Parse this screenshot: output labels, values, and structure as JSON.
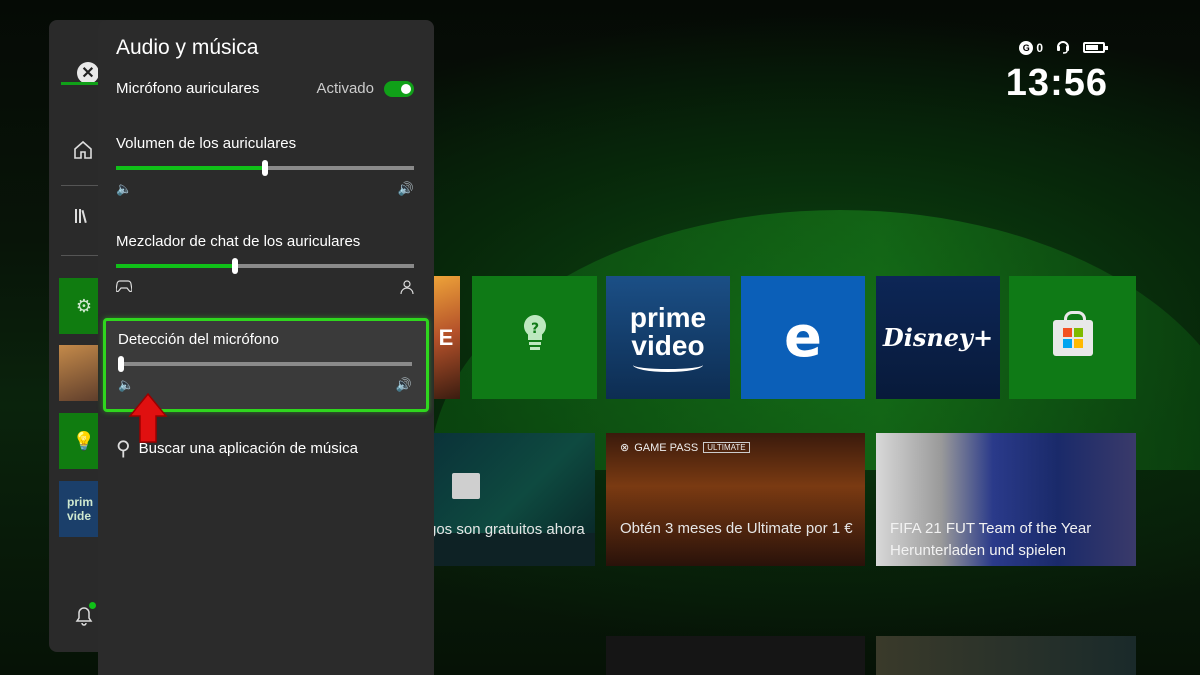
{
  "status": {
    "gamerscore_badge": "G",
    "gamerscore_count": "0",
    "time": "13:56"
  },
  "panel": {
    "title": "Audio y música",
    "mic_headset": {
      "label": "Micrófono auriculares",
      "state": "Activado",
      "enabled": true
    },
    "headset_volume": {
      "label": "Volumen de los auriculares",
      "value_percent": 50
    },
    "chat_mixer": {
      "label": "Mezclador de chat de los auriculares",
      "value_percent": 40
    },
    "mic_monitoring": {
      "label": "Detección del micrófono",
      "value_percent": 1
    },
    "music_search": {
      "label": "Buscar una aplicación de música"
    }
  },
  "tiles": {
    "fortnite": "E",
    "prime_line1": "prime",
    "prime_line2": "video",
    "edge": "e",
    "disney": "Disney+"
  },
  "cards": {
    "free_games": "gos son gratuitos ahora",
    "gamepass_badge": "GAME PASS",
    "gamepass_ultimate": "ULTIMATE",
    "gamepass_offer": "Obtén 3 meses de Ultimate por 1 €",
    "fifa": "FIFA 21 FUT Team of the Year Herunterladen und spielen"
  },
  "rail": {
    "prime_line1": "prim",
    "prime_line2": "vide"
  },
  "colors": {
    "accent": "#10c018",
    "focus_border": "#2fd61e",
    "panel_bg": "#2b2b2b",
    "annotation_arrow": "#e01010"
  }
}
